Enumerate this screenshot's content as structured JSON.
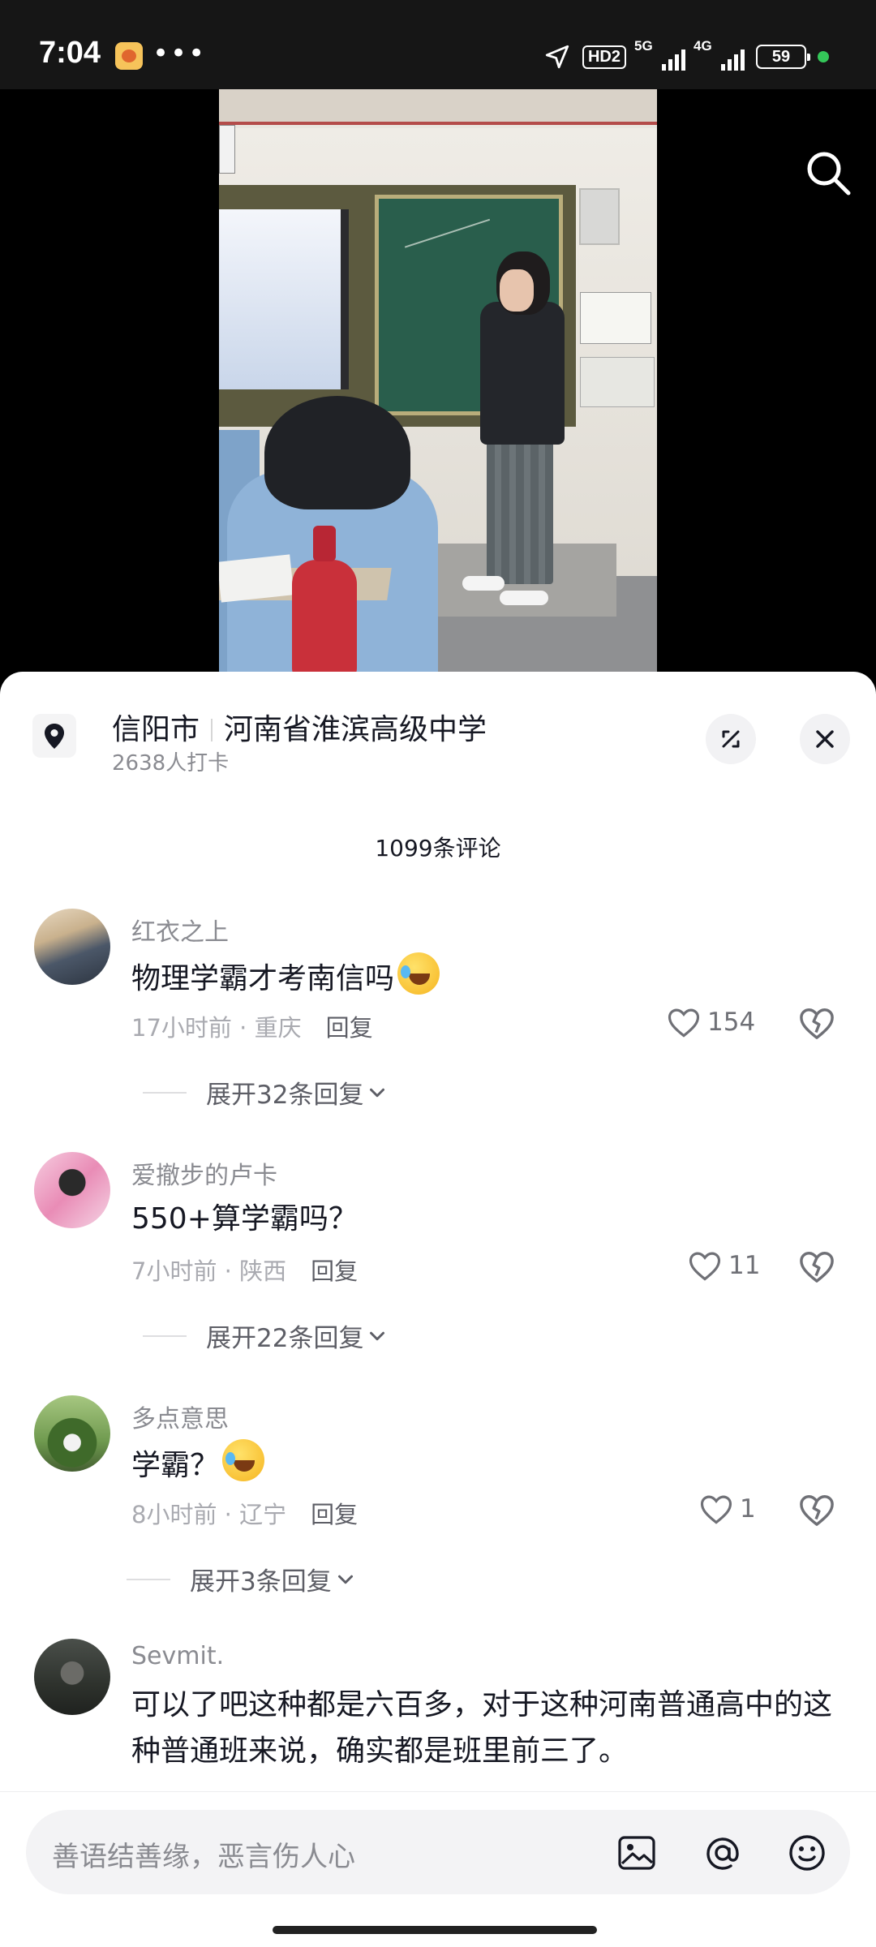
{
  "status_bar": {
    "time": "7:04",
    "dots": "•••",
    "hd": "HD2",
    "net1": "5G",
    "net2": "4G",
    "battery": "59"
  },
  "video": {
    "search_icon": "search-icon"
  },
  "location": {
    "city": "信阳市",
    "place": "河南省淮滨高级中学",
    "checkins": "2638人打卡"
  },
  "comments_count": "1099条评论",
  "comments": [
    {
      "user": "红衣之上",
      "text": "物理学霸才考南信吗",
      "time": "17小时前",
      "region": "重庆",
      "reply": "回复",
      "likes": "154",
      "expand": "展开32条回复"
    },
    {
      "user": "爱撤步的卢卡",
      "text": "550+算学霸吗？",
      "time": "7小时前",
      "region": "陕西",
      "reply": "回复",
      "likes": "11",
      "expand": "展开22条回复"
    },
    {
      "user": "多点意思",
      "text": "学霸？",
      "time": "8小时前",
      "region": "辽宁",
      "reply": "回复",
      "likes": "1",
      "expand": "展开3条回复"
    },
    {
      "user": "Sevmit.",
      "text": "可以了吧这种都是六百多，对于这种河南普通高中的这种普通班来说，确实都是班里前三了。"
    }
  ],
  "input": {
    "placeholder": "善语结善缘，恶言伤人心"
  },
  "colors": {
    "accent_text": "#161823",
    "secondary_text": "#8a8b91",
    "sheet_bg": "#ffffff"
  }
}
